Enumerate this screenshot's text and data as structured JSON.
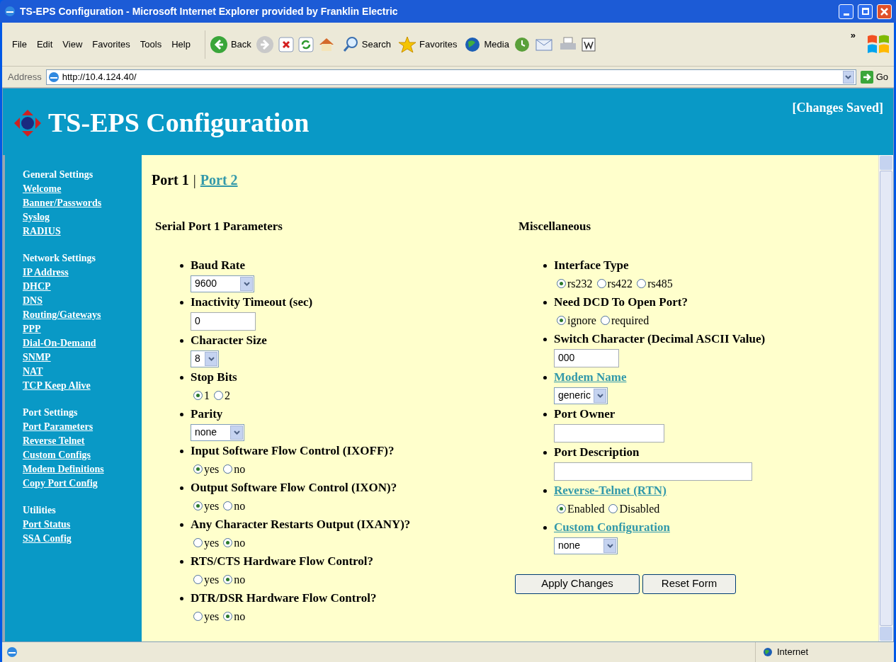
{
  "window": {
    "title": "TS-EPS Configuration - Microsoft Internet Explorer provided by Franklin Electric"
  },
  "menu": [
    "File",
    "Edit",
    "View",
    "Favorites",
    "Tools",
    "Help"
  ],
  "toolbar": [
    {
      "kind": "back",
      "label": "Back"
    },
    {
      "kind": "search",
      "label": "Search"
    },
    {
      "kind": "favorites",
      "label": "Favorites"
    },
    {
      "kind": "media",
      "label": "Media"
    }
  ],
  "toolbar_overflow": "»",
  "address": {
    "label": "Address",
    "value": "http://10.4.124.40/",
    "go": "Go"
  },
  "header": {
    "title": "TS-EPS Configuration",
    "status": "[Changes Saved]"
  },
  "sidebar": [
    {
      "heading": "General Settings",
      "links": [
        "Welcome",
        "Banner/Passwords",
        "Syslog",
        "RADIUS"
      ]
    },
    {
      "heading": "Network Settings",
      "links": [
        "IP Address",
        "DHCP",
        "DNS",
        "Routing/Gateways",
        "PPP",
        "Dial-On-Demand",
        "SNMP",
        "NAT",
        "TCP Keep Alive"
      ]
    },
    {
      "heading": "Port Settings",
      "links": [
        "Port Parameters",
        "Reverse Telnet",
        "Custom Configs",
        "Modem Definitions",
        "Copy Port Config"
      ]
    },
    {
      "heading": "Utilities",
      "links": [
        "Port Status",
        "SSA Config"
      ]
    }
  ],
  "tabs": [
    {
      "label": "Port 1",
      "selected": true
    },
    {
      "label": "Port 2",
      "selected": false
    }
  ],
  "tab_separator": "|",
  "sections": [
    {
      "title": "Serial Port 1 Parameters",
      "items": [
        {
          "label": "Baud Rate",
          "link": false,
          "kind": "select",
          "value": "9600"
        },
        {
          "label": "Inactivity Timeout (sec)",
          "link": false,
          "kind": "text",
          "value": "0"
        },
        {
          "label": "Character Size",
          "link": false,
          "kind": "select",
          "value": "8"
        },
        {
          "label": "Stop Bits",
          "link": false,
          "kind": "radio",
          "options": [
            {
              "label": "1",
              "selected": true
            },
            {
              "label": "2",
              "selected": false
            }
          ]
        },
        {
          "label": "Parity",
          "link": false,
          "kind": "select",
          "value": "none"
        },
        {
          "label": "Input Software Flow Control (IXOFF)?",
          "link": false,
          "kind": "radio",
          "options": [
            {
              "label": "yes",
              "selected": true
            },
            {
              "label": "no",
              "selected": false
            }
          ]
        },
        {
          "label": "Output Software Flow Control (IXON)?",
          "link": false,
          "kind": "radio",
          "options": [
            {
              "label": "yes",
              "selected": true
            },
            {
              "label": "no",
              "selected": false
            }
          ]
        },
        {
          "label": "Any Character Restarts Output (IXANY)?",
          "link": false,
          "kind": "radio",
          "options": [
            {
              "label": "yes",
              "selected": false
            },
            {
              "label": "no",
              "selected": true
            }
          ]
        },
        {
          "label": "RTS/CTS Hardware Flow Control?",
          "link": false,
          "kind": "radio",
          "options": [
            {
              "label": "yes",
              "selected": false
            },
            {
              "label": "no",
              "selected": true
            }
          ]
        },
        {
          "label": "DTR/DSR Hardware Flow Control?",
          "link": false,
          "kind": "radio",
          "options": [
            {
              "label": "yes",
              "selected": false
            },
            {
              "label": "no",
              "selected": true
            }
          ]
        }
      ]
    },
    {
      "title": "Miscellaneous",
      "items": [
        {
          "label": "Interface Type",
          "link": false,
          "kind": "radio",
          "options": [
            {
              "label": "rs232",
              "selected": true
            },
            {
              "label": "rs422",
              "selected": false
            },
            {
              "label": "rs485",
              "selected": false
            }
          ]
        },
        {
          "label": "Need DCD To Open Port?",
          "link": false,
          "kind": "radio",
          "options": [
            {
              "label": "ignore",
              "selected": true
            },
            {
              "label": "required",
              "selected": false
            }
          ]
        },
        {
          "label": "Switch Character (Decimal ASCII Value)",
          "link": false,
          "kind": "text",
          "value": "000"
        },
        {
          "label": "Modem Name",
          "link": true,
          "kind": "select",
          "value": "generic"
        },
        {
          "label": "Port Owner",
          "link": false,
          "kind": "text"
        },
        {
          "label": "Port Description",
          "link": false,
          "kind": "text"
        },
        {
          "label": "Reverse-Telnet (RTN)",
          "link": true,
          "kind": "radio",
          "options": [
            {
              "label": "Enabled",
              "selected": true
            },
            {
              "label": "Disabled",
              "selected": false
            }
          ]
        },
        {
          "label": "Custom Configuration",
          "link": true,
          "kind": "select",
          "value": "none"
        }
      ]
    }
  ],
  "buttons": [
    "Apply Changes",
    "Reset Form"
  ],
  "status_bar": {
    "zone": "Internet"
  }
}
